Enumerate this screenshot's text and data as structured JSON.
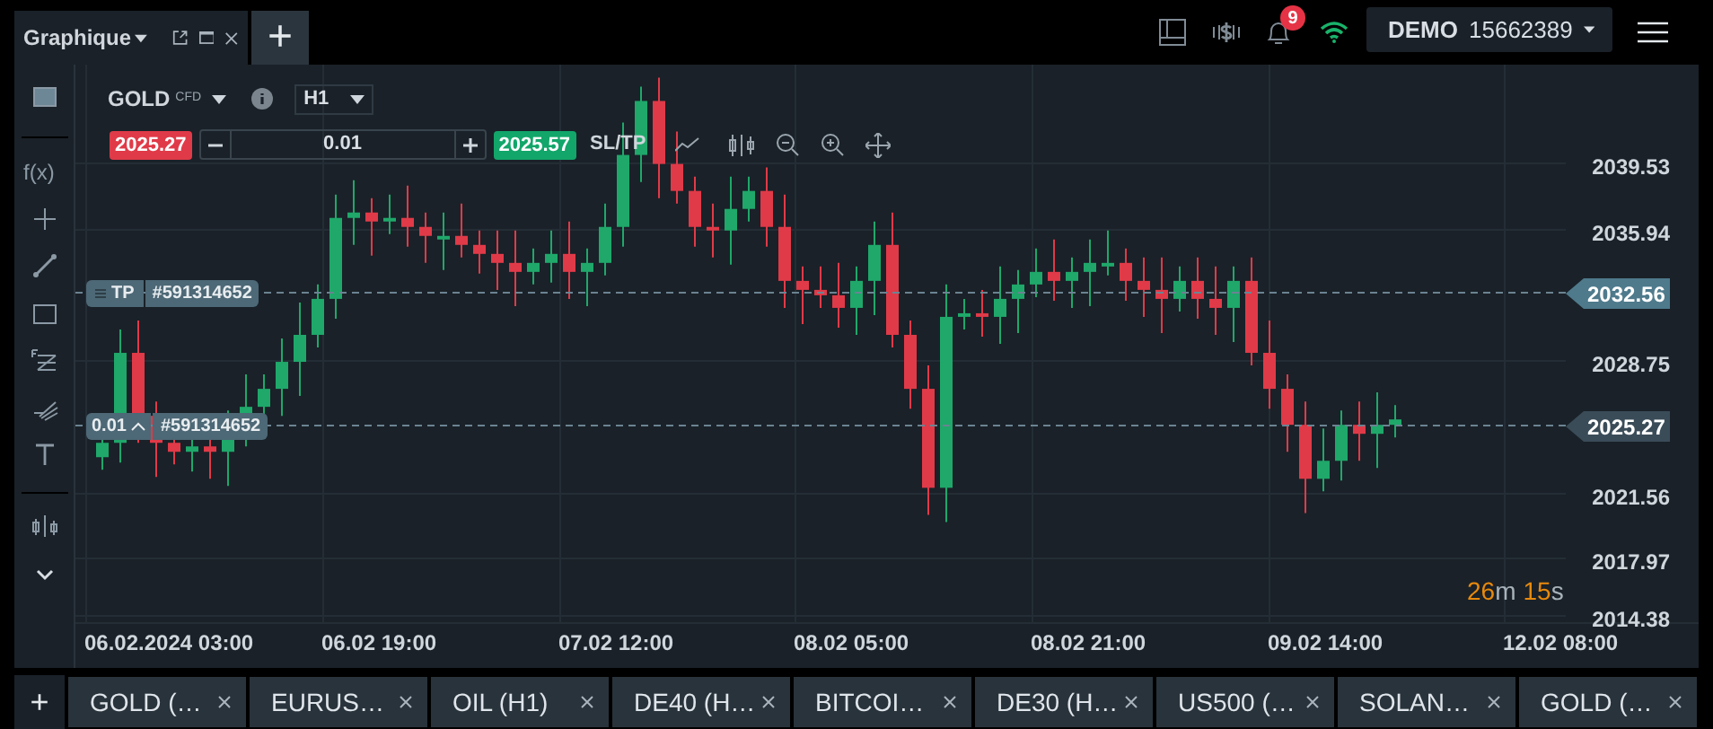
{
  "top_bar": {
    "panel_tab": {
      "title": "Graphique"
    },
    "add_tab_label": "+",
    "notifications_badge": "9",
    "account": {
      "mode": "DEMO",
      "number": "15662389"
    }
  },
  "drawing_tools": {
    "function_label": "f(x)"
  },
  "chart_toolbar": {
    "symbol": "GOLD",
    "symbol_type": "CFD",
    "timeframe": "H1",
    "sell_price": "2025.27",
    "volume": "0.01",
    "buy_price": "2025.57",
    "sl_tp": "SL/TP"
  },
  "price_axis": [
    "2039.53",
    "2035.94",
    "2028.75",
    "2021.56",
    "2017.97",
    "2014.38"
  ],
  "price_markers": [
    {
      "kind": "take_profit",
      "label": "2032.56"
    },
    {
      "kind": "current",
      "label": "2025.27"
    }
  ],
  "order_lines": [
    {
      "kind": "take_profit",
      "tag": "TP",
      "ticket": "#591314652"
    },
    {
      "kind": "position",
      "volume": "0.01",
      "ticket": "#591314652"
    }
  ],
  "time_axis": [
    "06.02.2024 03:00",
    "06.02 19:00",
    "07.02 12:00",
    "08.02 05:00",
    "08.02 21:00",
    "09.02 14:00",
    "12.02 08:00"
  ],
  "countdown": [
    {
      "kind": "value",
      "text": "26"
    },
    {
      "kind": "unit",
      "text": "m"
    },
    {
      "kind": "value",
      "text": "15"
    },
    {
      "kind": "unit",
      "text": "s"
    }
  ],
  "bottom_tabs": {
    "add_label": "+",
    "tabs": [
      {
        "label": "GOLD (…"
      },
      {
        "label": "EURUS…"
      },
      {
        "label": "OIL (H1)"
      },
      {
        "label": "DE40 (H…"
      },
      {
        "label": "BITCOI…"
      },
      {
        "label": "DE30 (H…"
      },
      {
        "label": "US500 (…"
      },
      {
        "label": "SOLAN…"
      },
      {
        "label": "GOLD (…"
      }
    ]
  }
}
